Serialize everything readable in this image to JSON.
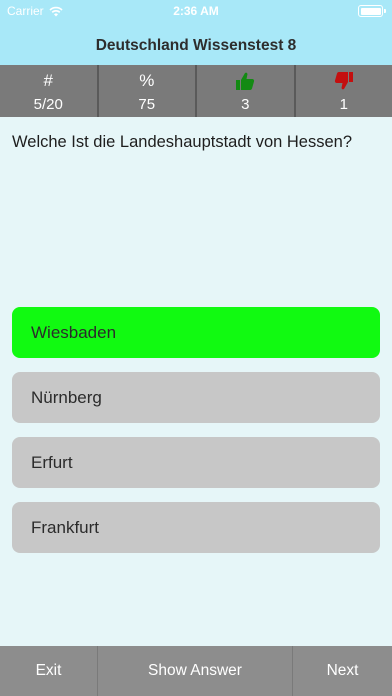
{
  "status_bar": {
    "carrier": "Carrier",
    "time": "2:36 AM"
  },
  "nav": {
    "title": "Deutschland Wissenstest 8"
  },
  "stats": [
    {
      "label": "#",
      "value": "5/20"
    },
    {
      "label": "%",
      "value": "75"
    },
    {
      "icon": "thumbs-up-icon",
      "icon_color": "#138a13",
      "value": "3"
    },
    {
      "icon": "thumbs-down-icon",
      "icon_color": "#c40f0f",
      "value": "1"
    }
  ],
  "question": "Welche Ist die Landeshauptstadt von Hessen?",
  "answers": [
    {
      "label": "Wiesbaden",
      "state": "correct"
    },
    {
      "label": "Nürnberg",
      "state": "default"
    },
    {
      "label": "Erfurt",
      "state": "default"
    },
    {
      "label": "Frankfurt",
      "state": "default"
    }
  ],
  "colors": {
    "header_bg": "#a8e8f8",
    "page_bg": "#e6f6f8",
    "stats_bg": "#7a7a7a",
    "correct": "#11fa11",
    "answer_default": "#c7c7c7",
    "bottom_bar_bg": "#8d8d8d"
  },
  "bottom_bar": {
    "exit": "Exit",
    "show_answer": "Show Answer",
    "next": "Next"
  }
}
